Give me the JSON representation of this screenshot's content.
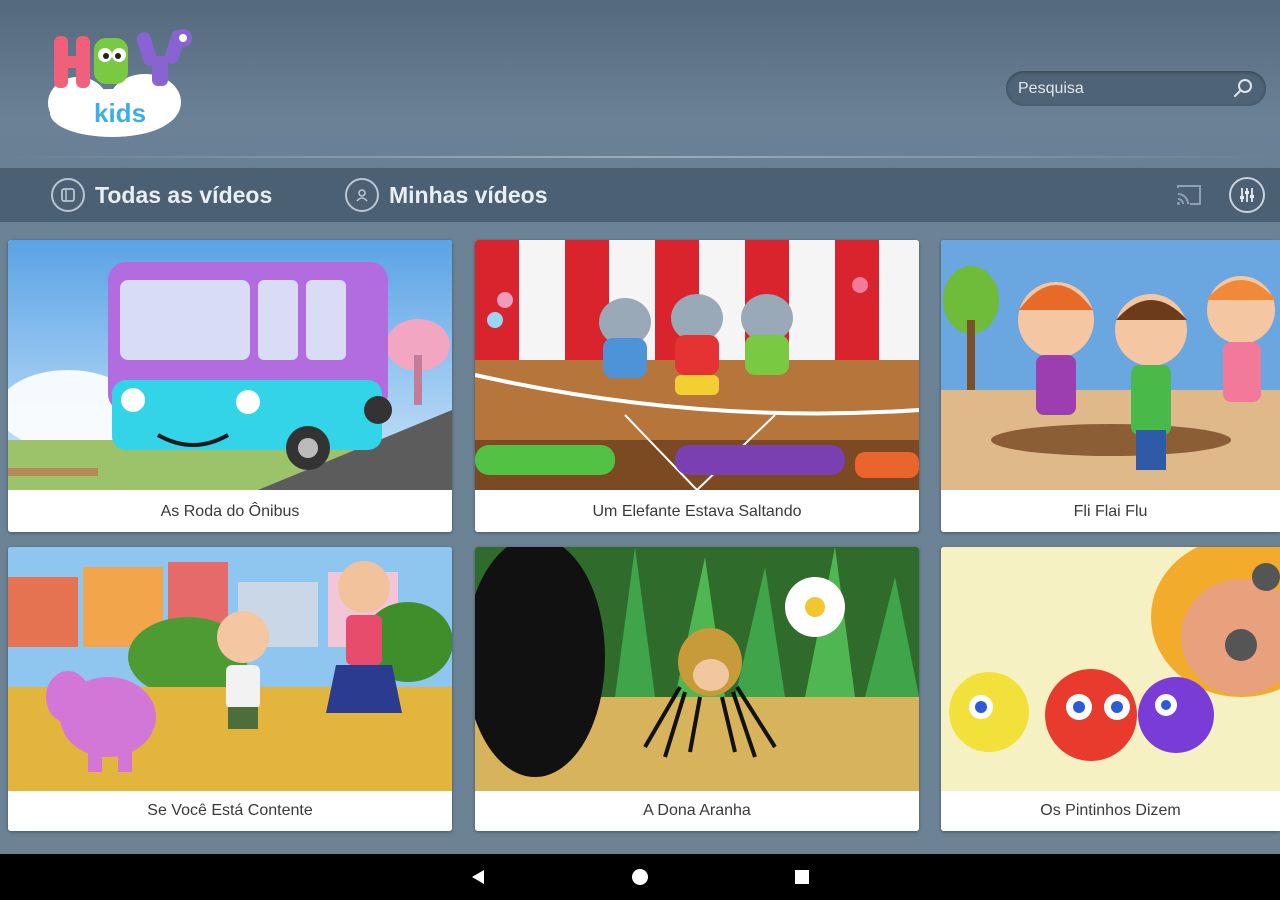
{
  "app": {
    "logo_word": "HEY",
    "logo_sub": "kids"
  },
  "search": {
    "placeholder": "Pesquisa",
    "icon": "search-icon"
  },
  "tabs": [
    {
      "label": "Todas as vídeos",
      "icon": "video-list-icon",
      "active": true
    },
    {
      "label": "Minhas vídeos",
      "icon": "user-icon",
      "active": false
    }
  ],
  "toolbar": {
    "cast_icon": "cast-icon",
    "settings_icon": "sliders-icon"
  },
  "videos": [
    {
      "title": "As Roda do Ônibus"
    },
    {
      "title": "Um Elefante Estava Saltando"
    },
    {
      "title": "Fli Flai Flu"
    },
    {
      "title": "Se Você Está Contente"
    },
    {
      "title": "A Dona Aranha"
    },
    {
      "title": "Os Pintinhos Dizem"
    }
  ],
  "system_nav": {
    "back_icon": "back-triangle-icon",
    "home_icon": "home-circle-icon",
    "recents_icon": "recents-square-icon"
  },
  "colors": {
    "header_bg": "#5f7487",
    "tabbar_bg": "#4c6073",
    "card_bg": "#ffffff",
    "nav_bg": "#000000"
  }
}
